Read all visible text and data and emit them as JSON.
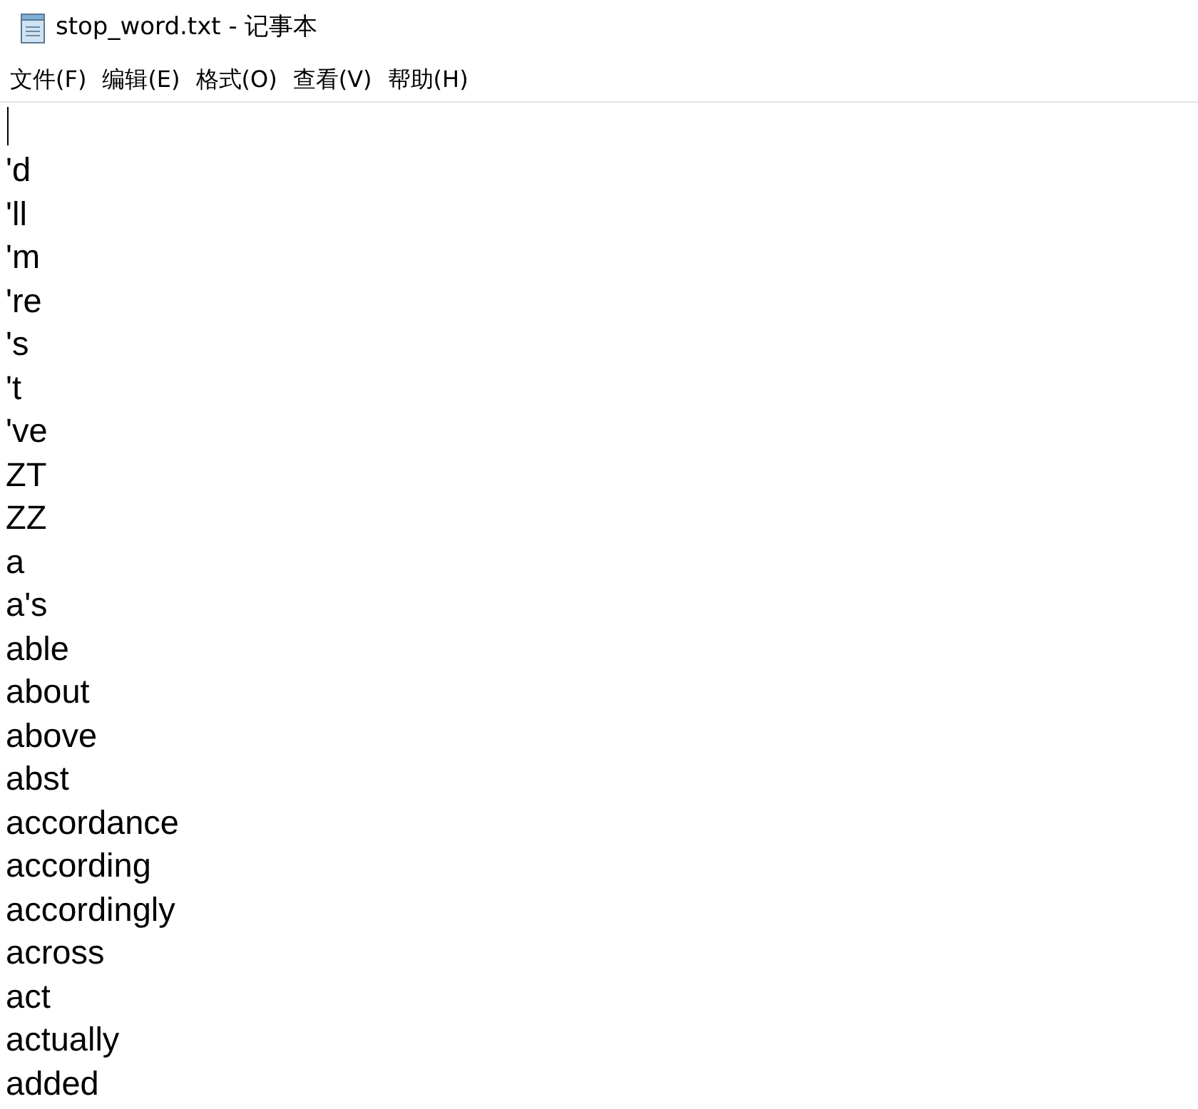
{
  "window": {
    "title": "stop_word.txt - 记事本"
  },
  "menu": [
    "文件(F)",
    "编辑(E)",
    "格式(O)",
    "查看(V)",
    "帮助(H)"
  ],
  "editor": {
    "lines": [
      "'d",
      "'ll",
      "'m",
      "'re",
      "'s",
      "'t",
      "'ve",
      "ZT",
      "ZZ",
      "a",
      "a's",
      "able",
      "about",
      "above",
      "abst",
      "accordance",
      "according",
      "accordingly",
      "across",
      "act",
      "actually",
      "added"
    ]
  }
}
